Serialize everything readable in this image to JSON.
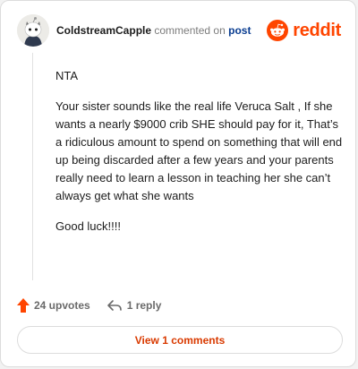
{
  "header": {
    "username": "ColdstreamCapple",
    "action_text": "commented on",
    "post_link": "post",
    "brand_name": "reddit",
    "brand_color": "#ff4500"
  },
  "comment": {
    "paragraphs": [
      "NTA",
      "Your sister sounds like the real life Veruca Salt , If she wants a nearly $9000 crib SHE should pay for it, That’s a ridiculous amount to spend on something that will end up being discarded after a few years and your parents really need to learn a lesson in teaching her she can’t always get what she wants",
      "Good luck!!!!"
    ]
  },
  "actions": {
    "upvotes": "24 upvotes",
    "replies": "1 reply",
    "upvote_icon": "upvote-arrow-icon",
    "reply_icon": "reply-arrow-icon",
    "upvote_color": "#ff4500"
  },
  "footer": {
    "view_comments": "View 1 comments",
    "button_text_color": "#d93a00"
  }
}
